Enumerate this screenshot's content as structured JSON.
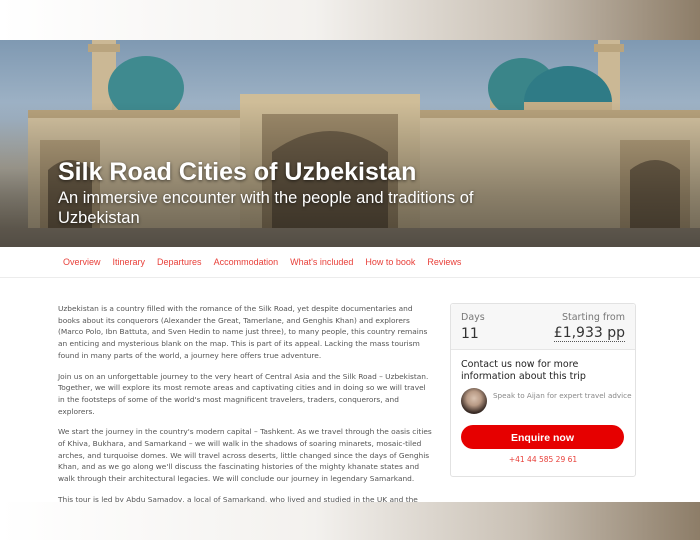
{
  "hero": {
    "title": "Silk Road Cities of Uzbekistan",
    "subtitle": "An immersive encounter with the people and traditions of Uzbekistan"
  },
  "tabs": [
    "Overview",
    "Itinerary",
    "Departures",
    "Accommodation",
    "What's included",
    "How to book",
    "Reviews"
  ],
  "content": {
    "paragraphs": [
      "Uzbekistan is a country filled with the romance of the Silk Road, yet despite documentaries and books about its conquerors (Alexander the Great, Tamerlane, and Genghis Khan) and explorers (Marco Polo, Ibn Battuta, and Sven Hedin to name just three), to many people, this country remains an enticing and mysterious blank on the map. This is part of its appeal. Lacking the mass tourism found in many parts of the world, a journey here offers true adventure.",
      "Join us on an unforgettable journey to the very heart of Central Asia and the Silk Road – Uzbekistan. Together, we will explore its most remote areas and captivating cities and in doing so we will travel in the footsteps of some of the world's most magnificent travelers, traders, conquerors, and explorers.",
      "We start the journey in the country's modern capital – Tashkent. As we travel through the oasis cities of Khiva, Bukhara, and Samarkand – we will walk in the shadows of soaring minarets, mosaic-tiled arches, and turquoise domes. We will travel across deserts, little changed since the days of Genghis Khan, and as we go along we'll discuss the fascinating histories of the mighty khanate states and walk through their architectural legacies. We will conclude our journey in legendary Samarkand.",
      "This tour is led by Abdu Samadov, a local of Samarkand, who lived and studied in the UK and the USA"
    ]
  },
  "booking": {
    "days_label": "Days",
    "days_value": "11",
    "price_label": "Starting from",
    "price_value": "£1,933 pp",
    "contact_heading": "Contact us now for more information about this trip",
    "agent_text": "Speak to Aijan for expert travel advice",
    "enquire_label": "Enquire now",
    "phone": "+41 44 585 29 61"
  },
  "colors": {
    "accent": "#e8403a",
    "button": "#e60000"
  }
}
